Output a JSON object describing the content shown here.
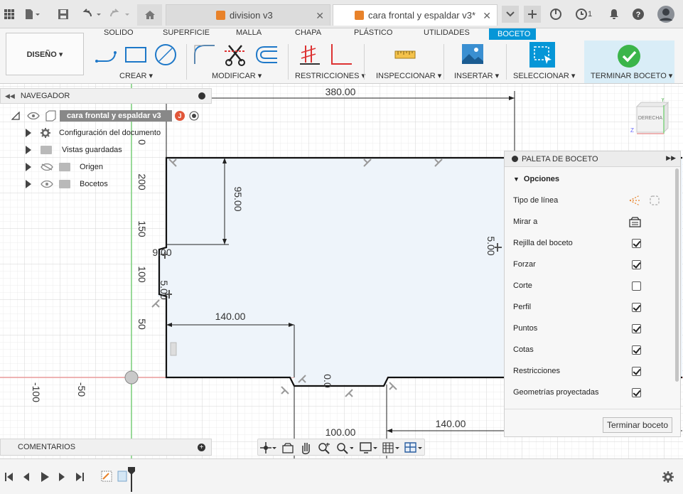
{
  "titlebar": {
    "tabs": [
      {
        "label": "division v3",
        "active": false
      },
      {
        "label": "cara frontal y espaldar v3*",
        "active": true
      }
    ],
    "notification_count": "1"
  },
  "ribbon": {
    "workspace_button": "DISEÑO ▾",
    "tabs": [
      "SOLIDO",
      "SUPERFICIE",
      "MALLA",
      "CHAPA",
      "PLÁSTICO",
      "UTILIDADES",
      "BOCETO"
    ],
    "active_tab": "BOCETO",
    "groups": {
      "create": "CREAR ▾",
      "modify": "MODIFICAR ▾",
      "constraints": "RESTRICCIONES ▾",
      "inspect": "INSPECCIONAR ▾",
      "insert": "INSERTAR ▾",
      "select": "SELECCIONAR ▾",
      "finish": "TERMINAR BOCETO ▾"
    }
  },
  "navigator": {
    "title": "NAVEGADOR",
    "root": "cara frontal y espaldar v3",
    "items": [
      {
        "label": "Configuración del documento"
      },
      {
        "label": "Vistas guardadas"
      },
      {
        "label": "Origen"
      },
      {
        "label": "Bocetos"
      }
    ]
  },
  "viewcube": {
    "label": "DERECHA"
  },
  "dimensions": {
    "top_width": "380.00",
    "notch_depth": "95.00",
    "lower_left": "140.00",
    "bottom_notch": "100.00",
    "lower_right": "140.00",
    "right_small": "5.00",
    "left_small": "5.00",
    "notch_small_a": "9.00",
    "notch_small_b": "0.0"
  },
  "rulers": {
    "vertical": [
      "0",
      "200",
      "150",
      "100",
      "50"
    ],
    "horizontal": [
      "-100",
      "-50"
    ]
  },
  "palette": {
    "title": "PALETA DE BOCETO",
    "section": "Opciones",
    "rows": [
      {
        "label": "Tipo de línea",
        "type": "icons"
      },
      {
        "label": "Mirar a",
        "type": "icon"
      },
      {
        "label": "Rejilla del boceto",
        "checked": true
      },
      {
        "label": "Forzar",
        "checked": true
      },
      {
        "label": "Corte",
        "checked": false
      },
      {
        "label": "Perfil",
        "checked": true
      },
      {
        "label": "Puntos",
        "checked": true
      },
      {
        "label": "Cotas",
        "checked": true
      },
      {
        "label": "Restricciones",
        "checked": true
      },
      {
        "label": "Geometrías proyectadas",
        "checked": true
      }
    ],
    "finish_button": "Terminar boceto"
  },
  "comments": {
    "title": "COMENTARIOS"
  },
  "colors": {
    "accent": "#0696d7",
    "finish_green": "#3bb54a",
    "sketch_fill": "#eef4fa"
  }
}
